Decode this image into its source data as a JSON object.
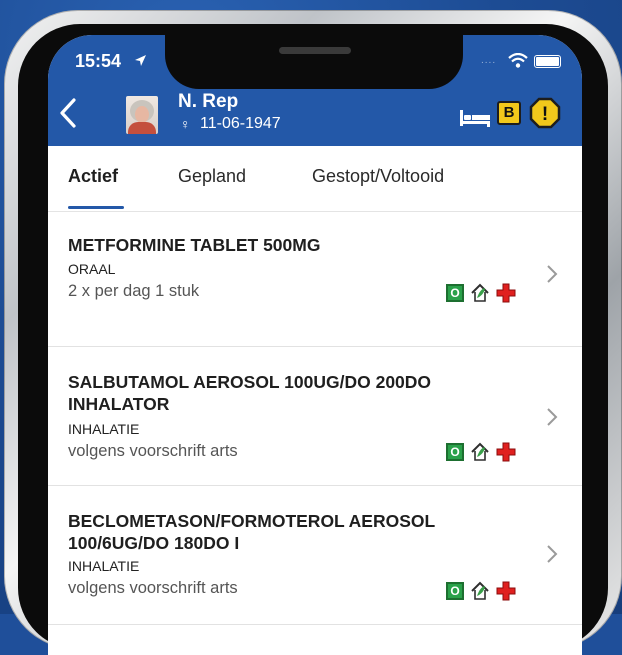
{
  "status_bar": {
    "time": "15:54",
    "signal": "...."
  },
  "header": {
    "patient_name": "N. Rep",
    "gender_symbol": "♀",
    "date_of_birth": "11-06-1947",
    "badge_label": "B",
    "alert_symbol": "!",
    "colors": {
      "bar": "#2358a8",
      "badge": "#f2c81b"
    }
  },
  "tabs": [
    {
      "label": "Actief",
      "active": true
    },
    {
      "label": "Gepland",
      "active": false
    },
    {
      "label": "Gestopt/Voltooid",
      "active": false
    }
  ],
  "medications": [
    {
      "name": "METFORMINE TABLET   500MG",
      "route": "ORAAL",
      "dosage": "2 x per dag 1 stuk",
      "icon_letter": "O"
    },
    {
      "name": "SALBUTAMOL AEROSOL 100UG/DO 200DO INHALATOR",
      "route": "INHALATIE",
      "dosage": "volgens voorschrift arts",
      "icon_letter": "O"
    },
    {
      "name": "BECLOMETASON/FORMOTEROL AEROSOL 100/6UG/DO 180DO I",
      "route": "INHALATIE",
      "dosage": "volgens voorschrift arts",
      "icon_letter": "O"
    }
  ]
}
